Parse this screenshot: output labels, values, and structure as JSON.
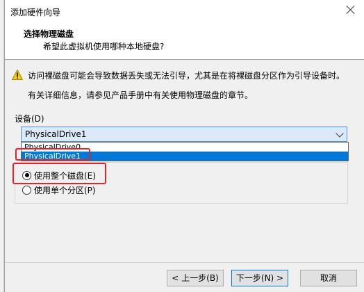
{
  "window": {
    "title": "添加硬件向导"
  },
  "header": {
    "title": "选择物理磁盘",
    "subtitle": "希望此虚拟机使用哪种本地硬盘?"
  },
  "warning": {
    "icon": "warning-icon",
    "text": "访问裸磁盘可能会导致数据丢失或无法引导，尤其是在将裸磁盘分区作为引导设备时。"
  },
  "info_text": "有关详细信息，请参见产品手册中有关使用物理磁盘的章节。",
  "device": {
    "label": "设备(D)",
    "selected": "PhysicalDrive1",
    "options": [
      "PhysicalDrive0",
      "PhysicalDrive1"
    ],
    "highlighted_option": "PhysicalDrive1"
  },
  "usage": {
    "options": [
      {
        "label": "使用整个磁盘(E)",
        "checked": true
      },
      {
        "label": "使用单个分区(P)",
        "checked": false
      }
    ]
  },
  "buttons": {
    "back": "< 上一步(B)",
    "next": "下一步(N) >",
    "cancel": "取消"
  },
  "colors": {
    "selection": "#0078d7",
    "annotation": "#e0242c"
  }
}
